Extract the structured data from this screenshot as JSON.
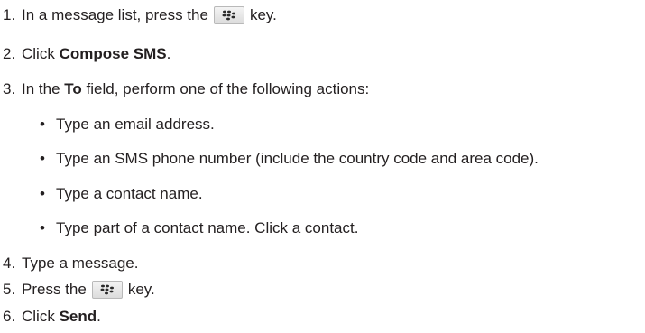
{
  "steps": [
    {
      "number": "1.",
      "before": "In a message list, press the",
      "key_icon": "blackberry-menu-key-icon",
      "after": "key."
    },
    {
      "number": "2.",
      "before": "Click ",
      "bold": "Compose SMS",
      "after": "."
    },
    {
      "number": "3.",
      "before": "In the ",
      "bold": "To",
      "after": " field, perform one of the following actions:"
    },
    {
      "number": "4.",
      "text": "Type a message."
    },
    {
      "number": "5.",
      "before": "Press the",
      "key_icon": "blackberry-menu-key-icon",
      "after": "key."
    },
    {
      "number": "6.",
      "before": "Click ",
      "bold": "Send",
      "after": "."
    }
  ],
  "bullets": [
    "Type an email address.",
    "Type an SMS phone number (include the country code and area code).",
    "Type a contact name.",
    "Type part of a contact name. Click a contact."
  ],
  "bullet_char": "•"
}
